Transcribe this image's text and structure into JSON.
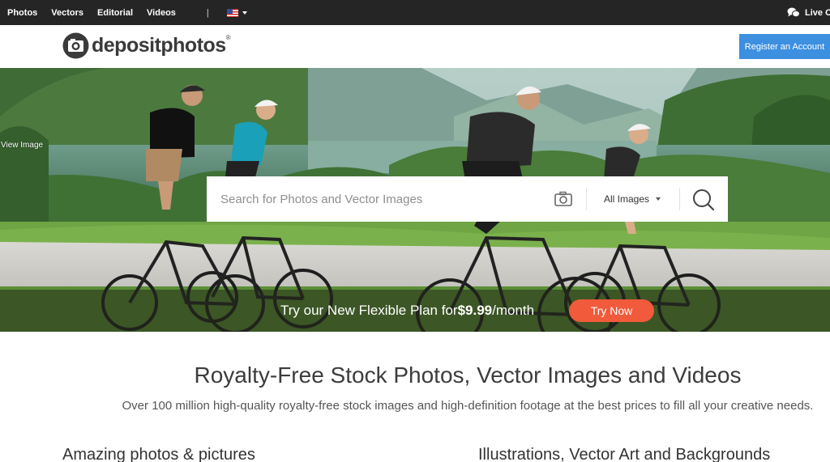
{
  "topnav": {
    "links": [
      "Photos",
      "Vectors",
      "Editorial",
      "Videos"
    ],
    "separator": "|",
    "language_flag": "us-flag-icon",
    "live_chat_label": "Live C"
  },
  "header": {
    "logo_text": "depositphotos",
    "logo_mark": "®",
    "register_label": "Register an Account"
  },
  "hero": {
    "view_image_label": "View Image",
    "search": {
      "placeholder": "Search for Photos and Vector Images",
      "value": "",
      "type_selected": "All Images"
    },
    "promo": {
      "text_before": "Try our New Flexible Plan for ",
      "price": "$9.99",
      "text_after": "/month",
      "cta_label": "Try Now"
    }
  },
  "content": {
    "title": "Royalty-Free Stock Photos, Vector Images and Videos",
    "subtitle": "Over 100 million high-quality royalty-free stock images and high-definition footage at the best prices to fill all your creative needs.",
    "column_heading_left": "Amazing photos & pictures",
    "column_heading_right": "Illustrations, Vector Art and Backgrounds"
  },
  "colors": {
    "topbar": "#252525",
    "register_button": "#3d8fe0",
    "cta_button": "#f15a3a",
    "promo_overlay": "rgba(35,40,25,0.55)"
  }
}
